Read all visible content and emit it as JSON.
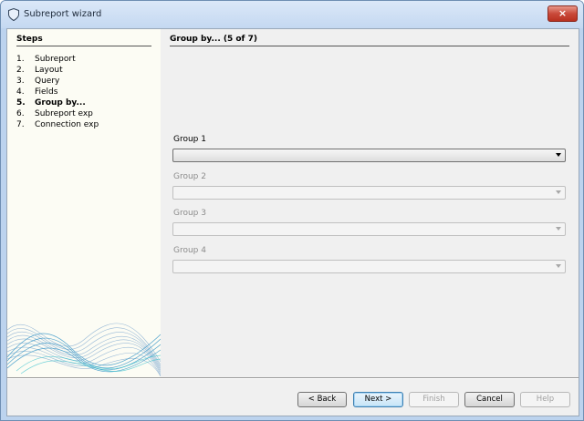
{
  "window": {
    "title": "Subreport wizard",
    "close_label": "×"
  },
  "steps": {
    "title": "Steps",
    "items": [
      {
        "num": "1.",
        "label": "Subreport"
      },
      {
        "num": "2.",
        "label": "Layout"
      },
      {
        "num": "3.",
        "label": "Query"
      },
      {
        "num": "4.",
        "label": "Fields"
      },
      {
        "num": "5.",
        "label": "Group by..."
      },
      {
        "num": "6.",
        "label": "Subreport exp"
      },
      {
        "num": "7.",
        "label": "Connection exp"
      }
    ],
    "current_index": 4
  },
  "content": {
    "title": "Group by... (5 of 7)",
    "groups": [
      {
        "label": "Group 1",
        "value": "",
        "enabled": true
      },
      {
        "label": "Group 2",
        "value": "",
        "enabled": false
      },
      {
        "label": "Group 3",
        "value": "",
        "enabled": false
      },
      {
        "label": "Group 4",
        "value": "",
        "enabled": false
      }
    ]
  },
  "buttons": {
    "back": "< Back",
    "next": "Next >",
    "finish": "Finish",
    "cancel": "Cancel",
    "help": "Help"
  },
  "icons": {
    "window": "shield-icon",
    "close": "close-icon",
    "dropdown": "chevron-down-icon"
  },
  "colors": {
    "titlebar": "#c4d8f1",
    "close_button": "#c94a3a",
    "steps_background": "#fcfcf4",
    "content_background": "#f0f0f0"
  }
}
